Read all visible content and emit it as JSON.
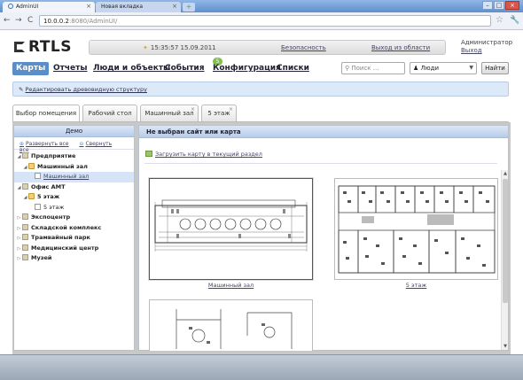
{
  "browser": {
    "tabs": [
      {
        "label": "AdminUI"
      },
      {
        "label": "Новая вкладка"
      }
    ],
    "url_host": "10.0.0.2",
    "url_path": ":8080/AdminUI/"
  },
  "header": {
    "logo_text": "RTLS",
    "datetime": "15:35:57 15.09.2011",
    "security_link": "Безопасность",
    "logout_area_link": "Выход из области",
    "user_name": "Администратор",
    "user_logout": "Выход"
  },
  "nav": {
    "items": [
      {
        "label": "Карты"
      },
      {
        "label": "Отчеты"
      },
      {
        "label": "Люди и объекты"
      },
      {
        "label": "События"
      },
      {
        "label": "Конфигурация"
      },
      {
        "label": "Списки"
      }
    ],
    "events_badge": "5",
    "search_placeholder": "Поиск ...",
    "filter_value": "Люди",
    "find_button": "Найти"
  },
  "infobar": {
    "link": "Редактировать древовидную структуру"
  },
  "content_tabs": [
    {
      "label": "Выбор помещения"
    },
    {
      "label": "Рабочий стол"
    },
    {
      "label": "Машинный зал"
    },
    {
      "label": "5 этаж"
    }
  ],
  "tree_panel": {
    "title": "Демо",
    "expand_all": "Развернуть все",
    "collapse_all": "Свернуть все",
    "nodes": [
      {
        "label": "Предприятие"
      },
      {
        "label": "Машинный зал"
      },
      {
        "label": "Машинный зал"
      },
      {
        "label": "Офис АМТ"
      },
      {
        "label": "5 этаж"
      },
      {
        "label": "5 этаж"
      },
      {
        "label": "Экспоцентр"
      },
      {
        "label": "Складской комплекс"
      },
      {
        "label": "Трамвайный парк"
      },
      {
        "label": "Медицинский центр"
      },
      {
        "label": "Музей"
      }
    ]
  },
  "maps_panel": {
    "title": "Не выбран сайт или карта",
    "upload_link": "Загрузить карту в текущий раздел",
    "maps": [
      {
        "label": "Машинный зал"
      },
      {
        "label": "5 этаж"
      }
    ]
  }
}
